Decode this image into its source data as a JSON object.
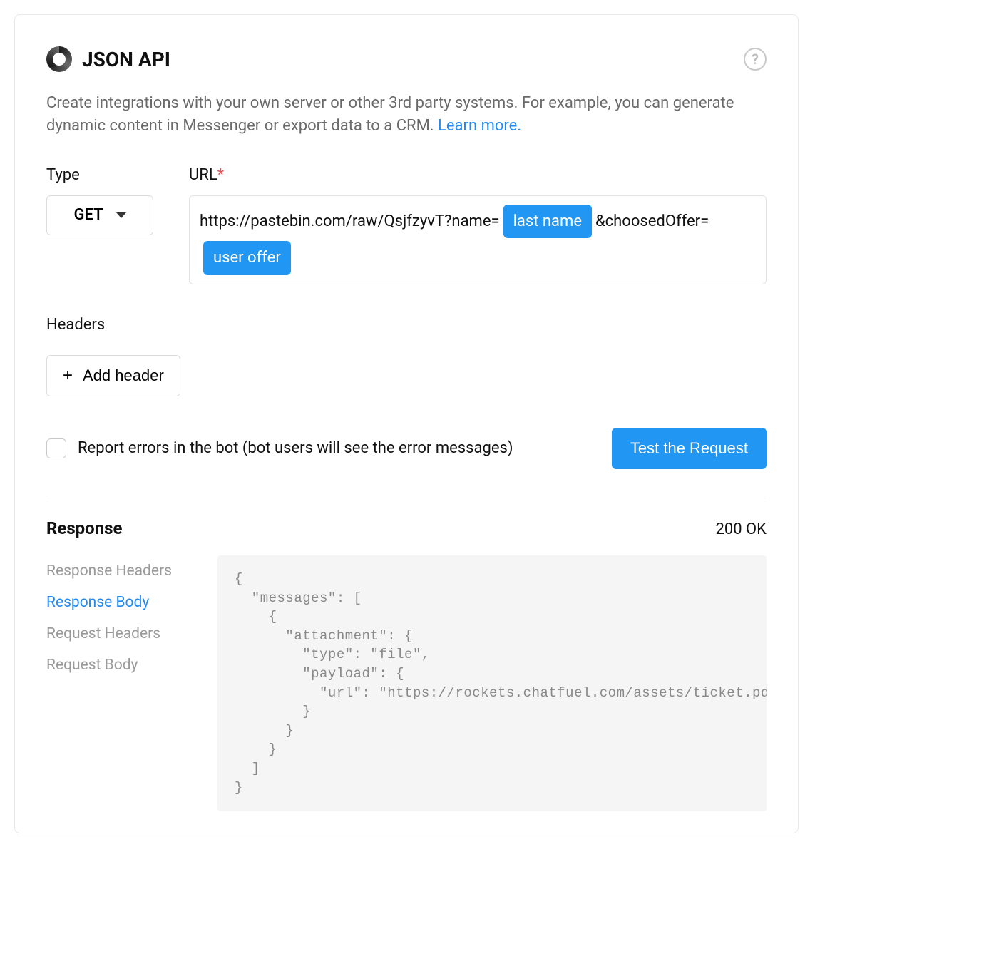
{
  "header": {
    "title": "JSON API"
  },
  "description": {
    "text": "Create integrations with your own server or other 3rd party systems. For example, you can generate dynamic content in Messenger or export data to a CRM.  ",
    "link_text": "Learn more."
  },
  "form": {
    "type_label": "Type",
    "type_value": "GET",
    "url_label": "URL",
    "url_parts": {
      "p1": "https://pastebin.com/raw/QsjfzyvT?name=",
      "chip1": "last name",
      "p2": "&choosedOffer=",
      "chip2": "user offer"
    }
  },
  "headers_section": {
    "label": "Headers",
    "add_button": "Add header"
  },
  "actions": {
    "report_errors_label": "Report errors in the bot (bot users will see the error messages)",
    "test_button": "Test the Request"
  },
  "response": {
    "title": "Response",
    "status": "200 OK",
    "nav": {
      "response_headers": "Response Headers",
      "response_body": "Response Body",
      "request_headers": "Request Headers",
      "request_body": "Request Body"
    },
    "body_code": "{\n  \"messages\": [\n    {\n      \"attachment\": {\n        \"type\": \"file\",\n        \"payload\": {\n          \"url\": \"https://rockets.chatfuel.com/assets/ticket.pdf\"\n        }\n      }\n    }\n  ]\n}"
  }
}
